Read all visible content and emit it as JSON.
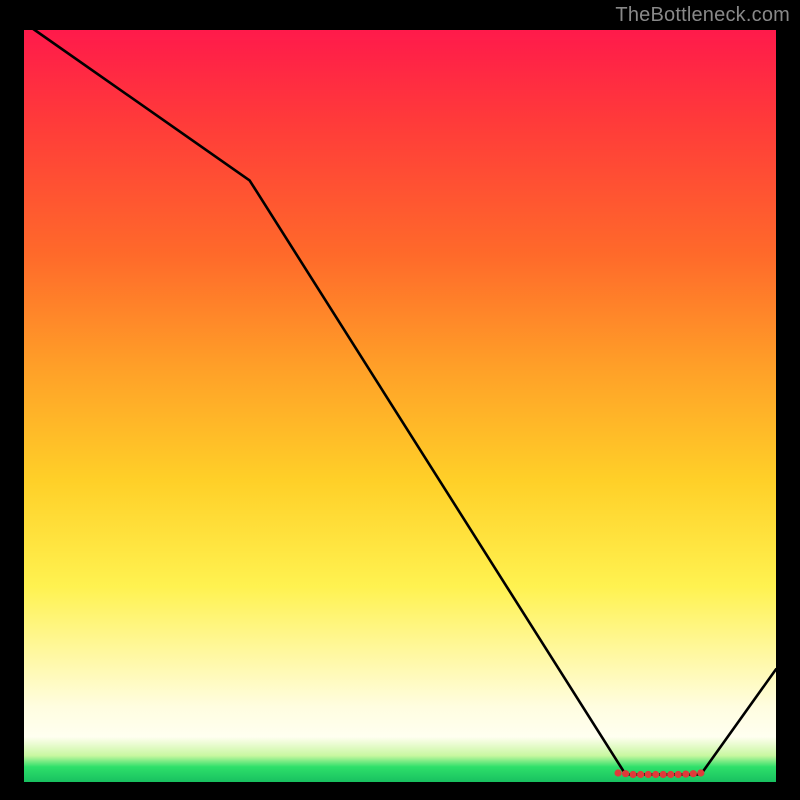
{
  "attribution": "TheBottleneck.com",
  "chart_data": {
    "type": "line",
    "title": "",
    "xlabel": "",
    "ylabel": "",
    "xlim": [
      0,
      100
    ],
    "ylim": [
      0,
      100
    ],
    "series": [
      {
        "name": "curve",
        "x": [
          0,
          30,
          80,
          90,
          100
        ],
        "values": [
          101,
          80,
          1,
          1,
          15
        ]
      }
    ],
    "markers": {
      "name": "flat-region-dots",
      "x": [
        79,
        80,
        81,
        82,
        83,
        84,
        85,
        86,
        87,
        88,
        89,
        90
      ],
      "values": [
        1.2,
        1.1,
        1.0,
        1.0,
        1.0,
        1.0,
        1.0,
        1.0,
        1.0,
        1.05,
        1.1,
        1.2
      ],
      "color": "#e03a3a"
    },
    "gradient_stops": [
      {
        "pct": 0,
        "color": "#ff1a4b"
      },
      {
        "pct": 12,
        "color": "#ff3a3a"
      },
      {
        "pct": 30,
        "color": "#ff6a2a"
      },
      {
        "pct": 45,
        "color": "#ffa028"
      },
      {
        "pct": 60,
        "color": "#ffd028"
      },
      {
        "pct": 74,
        "color": "#fff250"
      },
      {
        "pct": 90,
        "color": "#fffde0"
      },
      {
        "pct": 94,
        "color": "#fffff0"
      },
      {
        "pct": 96.5,
        "color": "#c8f7a0"
      },
      {
        "pct": 98,
        "color": "#2ee06a"
      },
      {
        "pct": 100,
        "color": "#18c060"
      }
    ]
  }
}
